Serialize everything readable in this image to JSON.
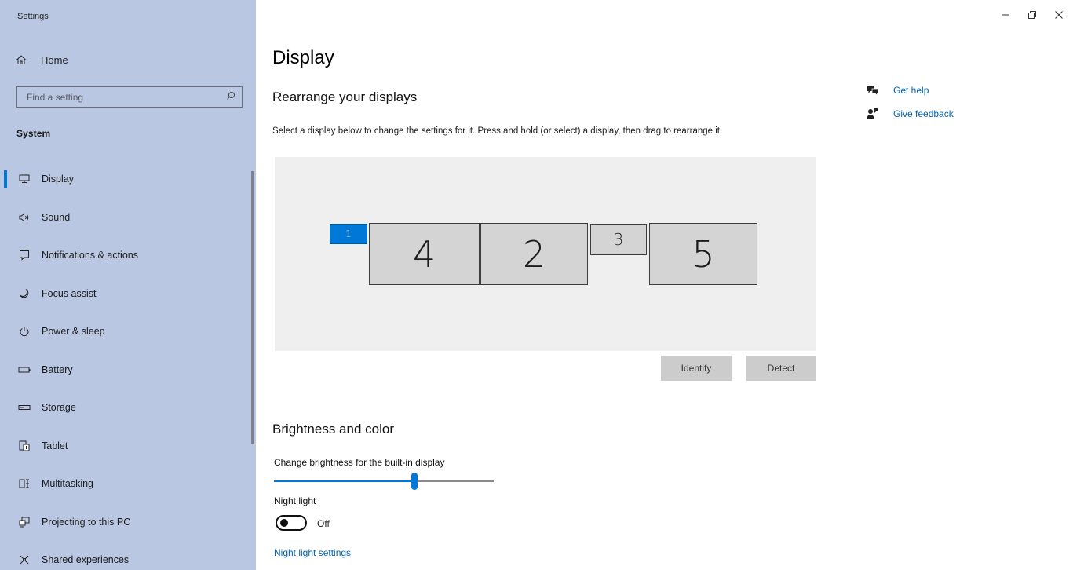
{
  "window": {
    "title": "Settings",
    "controls": {
      "minimize_icon": "minimize-icon",
      "restore_icon": "restore-icon",
      "close_icon": "close-icon"
    }
  },
  "sidebar": {
    "home_label": "Home",
    "search": {
      "placeholder": "Find a setting",
      "icon": "search-icon"
    },
    "section_title": "System",
    "items": [
      {
        "label": "Display",
        "icon": "monitor-icon",
        "active": true
      },
      {
        "label": "Sound",
        "icon": "speaker-icon"
      },
      {
        "label": "Notifications & actions",
        "icon": "notification-icon"
      },
      {
        "label": "Focus assist",
        "icon": "moon-icon"
      },
      {
        "label": "Power & sleep",
        "icon": "power-icon"
      },
      {
        "label": "Battery",
        "icon": "battery-icon"
      },
      {
        "label": "Storage",
        "icon": "storage-icon"
      },
      {
        "label": "Tablet",
        "icon": "tablet-icon"
      },
      {
        "label": "Multitasking",
        "icon": "multitasking-icon"
      },
      {
        "label": "Projecting to this PC",
        "icon": "projecting-icon"
      },
      {
        "label": "Shared experiences",
        "icon": "shared-experiences-icon"
      }
    ]
  },
  "main": {
    "page_title": "Display",
    "rearrange": {
      "heading": "Rearrange your displays",
      "description": "Select a display below to change the settings for it. Press and hold (or select) a display, then drag to rearrange it.",
      "monitors": [
        {
          "number": "1",
          "selected": true
        },
        {
          "number": "4",
          "selected": false
        },
        {
          "number": "2",
          "selected": false
        },
        {
          "number": "3",
          "selected": false
        },
        {
          "number": "5",
          "selected": false
        }
      ],
      "identify_label": "Identify",
      "detect_label": "Detect"
    },
    "brightness": {
      "heading": "Brightness and color",
      "slider_label": "Change brightness for the built-in display",
      "value_percent": 64,
      "night_light_label": "Night light",
      "night_light_state": "Off",
      "night_light_link": "Night light settings"
    }
  },
  "help": {
    "get_help": "Get help",
    "give_feedback": "Give feedback"
  },
  "colors": {
    "accent": "#0078d7",
    "sidebar_bg": "#b9c7e3",
    "link": "#0063b1"
  }
}
